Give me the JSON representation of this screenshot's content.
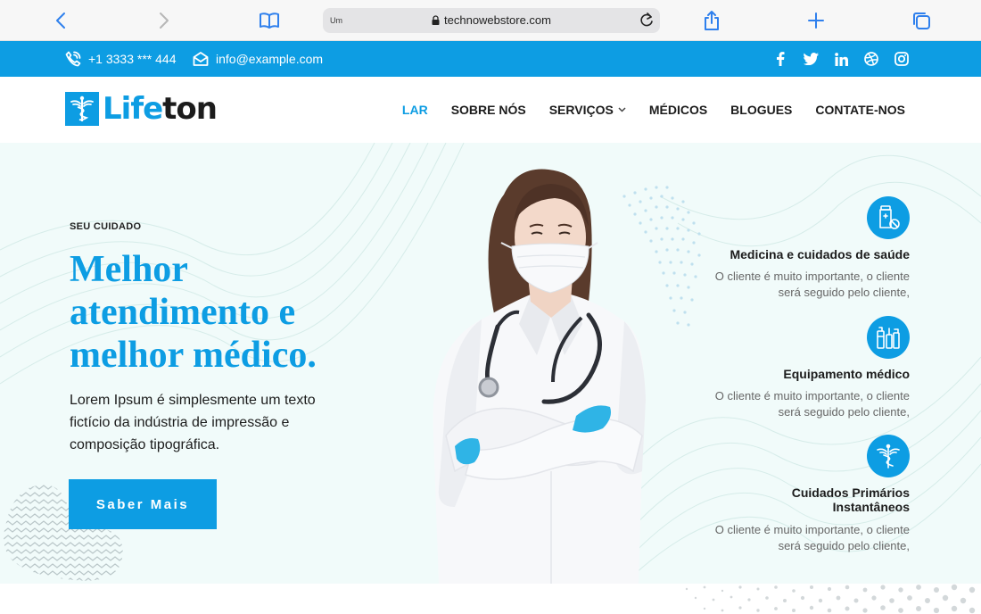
{
  "browser": {
    "reader_label": "Um",
    "url": "technowebstore.com"
  },
  "topbar": {
    "phone": "+1 3333 *** 444",
    "email": "info@example.com",
    "socials": [
      "facebook-icon",
      "twitter-icon",
      "linkedin-icon",
      "dribbble-icon",
      "instagram-icon"
    ]
  },
  "header": {
    "logo_part1": "Life",
    "logo_part2": "ton",
    "nav": [
      {
        "label": "LAR",
        "active": true
      },
      {
        "label": "SOBRE NÓS"
      },
      {
        "label": "SERVIÇOS",
        "dropdown": true
      },
      {
        "label": "MÉDICOS"
      },
      {
        "label": "BLOGUES"
      },
      {
        "label": "CONTATE-NOS"
      }
    ]
  },
  "hero": {
    "eyebrow": "SEU CUIDADO",
    "title": "Melhor atendimento e melhor médico.",
    "description": "Lorem Ipsum é simplesmente um texto fictício da indústria de impressão e composição tipográfica.",
    "button": "Saber Mais"
  },
  "features": [
    {
      "icon": "medicine-bottle-icon",
      "title": "Medicina e cuidados de saúde",
      "desc_line1": "O cliente é muito importante, o cliente",
      "desc_line2": "será seguido pelo cliente,"
    },
    {
      "icon": "medical-equipment-icon",
      "title": "Equipamento médico",
      "desc_line1": "O cliente é muito importante, o cliente",
      "desc_line2": "será seguido pelo cliente,"
    },
    {
      "icon": "caduceus-icon",
      "title": "Cuidados Primários Instantâneos",
      "desc_line1": "O cliente é muito importante, o cliente",
      "desc_line2": "será seguido pelo cliente,"
    }
  ],
  "colors": {
    "accent": "#0d9de3",
    "hero_bg": "#f1fbfa"
  }
}
